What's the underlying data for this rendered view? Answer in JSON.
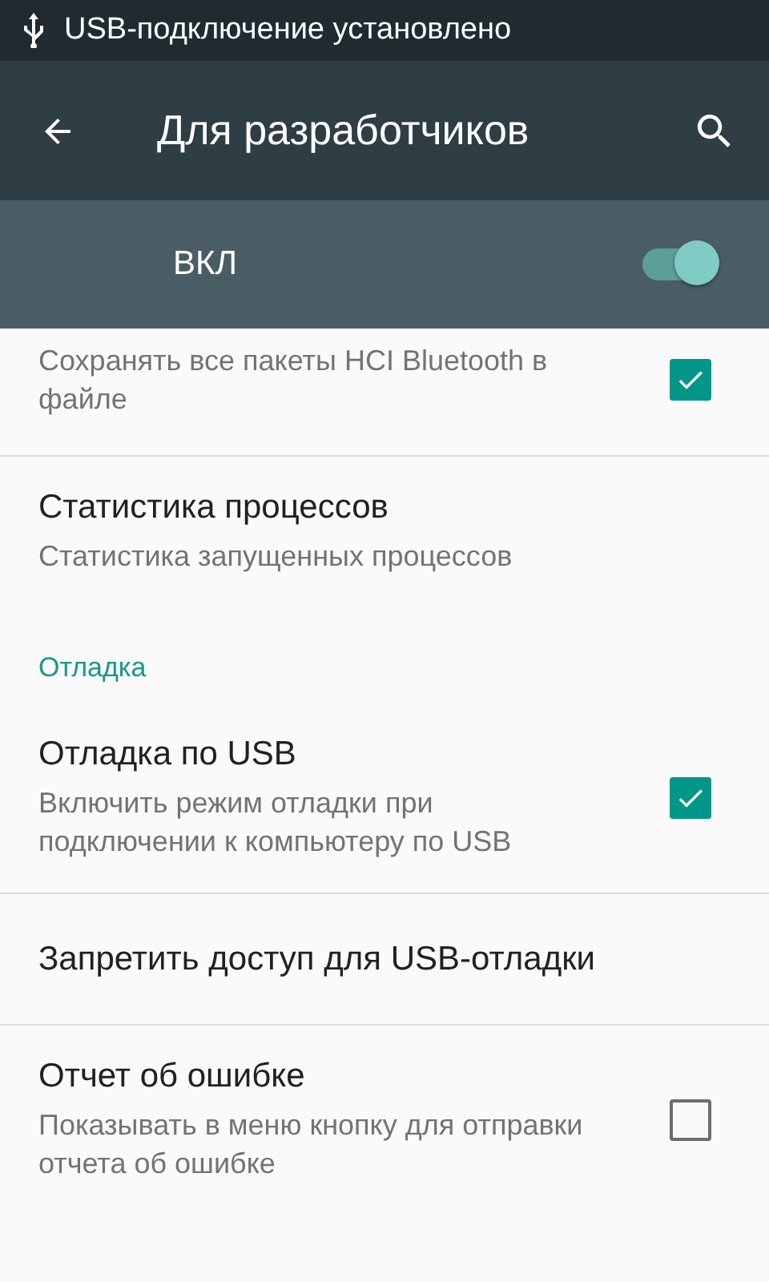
{
  "status_bar": {
    "text": "USB-подключение установлено"
  },
  "toolbar": {
    "title": "Для разработчиков"
  },
  "master_switch": {
    "label": "ВКЛ",
    "on": true
  },
  "items": [
    {
      "kind": "setting",
      "subtitle": "Сохранять все пакеты HCI Bluetooth в файле",
      "checked": true
    },
    {
      "kind": "setting",
      "title": "Статистика процессов",
      "subtitle": "Статистика запущенных процессов"
    },
    {
      "kind": "category",
      "title": "Отладка"
    },
    {
      "kind": "setting",
      "title": "Отладка по USB",
      "subtitle": "Включить режим отладки при подключении к компьютеру по USB",
      "checked": true
    },
    {
      "kind": "setting",
      "title": "Запретить доступ для USB-отладки"
    },
    {
      "kind": "setting",
      "title": "Отчет об ошибке",
      "subtitle": "Показывать в меню кнопку для отправки отчета об ошибке",
      "checked": false
    }
  ]
}
